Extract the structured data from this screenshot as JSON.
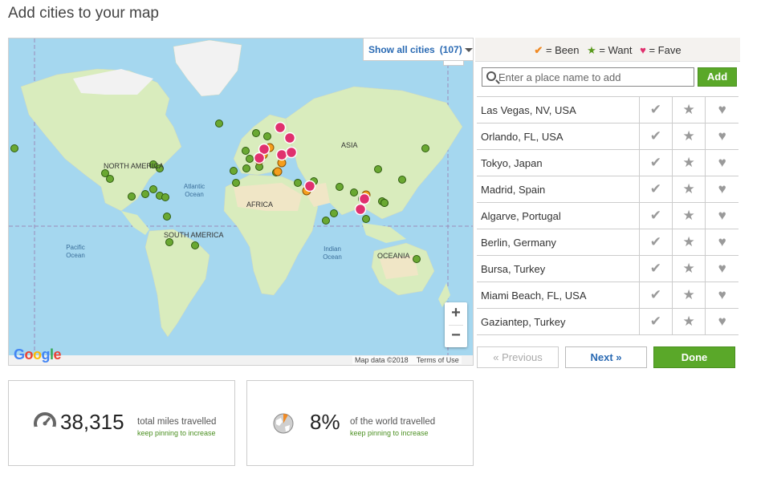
{
  "page_title": "Add cities to your map",
  "map": {
    "show_all_label": "Show all cities",
    "show_all_count": "(107)",
    "zoom_in": "+",
    "zoom_out": "−",
    "attribution_data": "Map data ©2018",
    "attribution_terms": "Terms of Use",
    "google_letters": [
      "G",
      "o",
      "o",
      "g",
      "l",
      "e"
    ],
    "google_colors": [
      "#4285f4",
      "#ea4335",
      "#fbbc05",
      "#4285f4",
      "#34a853",
      "#ea4335"
    ],
    "labels": {
      "north_america": "NORTH AMERICA",
      "south_america": "SOUTH AMERICA",
      "africa": "AFRICA",
      "asia": "ASIA",
      "oceania": "OCEANIA",
      "atlantic": "Atlantic Ocean",
      "pacific": "Pacific Ocean",
      "indian": "Indian Ocean"
    },
    "colors": {
      "water": "#a5d7ef",
      "land": "#d9ecbd",
      "ice": "#f2f2f2",
      "desert": "#f0e6c6"
    }
  },
  "legend": {
    "been_icon": "check-icon",
    "been_label": "= Been",
    "want_icon": "star-icon",
    "want_label": "= Want",
    "fave_icon": "heart-icon",
    "fave_label": "= Fave",
    "colors": {
      "been": "#f08a24",
      "want": "#5a9a1e",
      "fave": "#e0306e"
    }
  },
  "search": {
    "placeholder": "Enter a place name to add",
    "add_label": "Add"
  },
  "cities": [
    {
      "name": "Las Vegas, NV, USA"
    },
    {
      "name": "Orlando, FL, USA"
    },
    {
      "name": "Tokyo, Japan"
    },
    {
      "name": "Madrid, Spain"
    },
    {
      "name": "Algarve, Portugal"
    },
    {
      "name": "Berlin, Germany"
    },
    {
      "name": "Bursa, Turkey"
    },
    {
      "name": "Miami Beach, FL, USA"
    },
    {
      "name": "Gaziantep, Turkey"
    }
  ],
  "pager": {
    "previous_label": "« Previous",
    "next_label": "Next »",
    "done_label": "Done"
  },
  "stats": {
    "miles_value": "38,315",
    "miles_label": "total miles travelled",
    "miles_sub": "keep pinning to increase",
    "world_value": "8%",
    "world_label": "of the world travelled",
    "world_sub": "keep pinning to increase",
    "world_fraction": 0.08
  }
}
